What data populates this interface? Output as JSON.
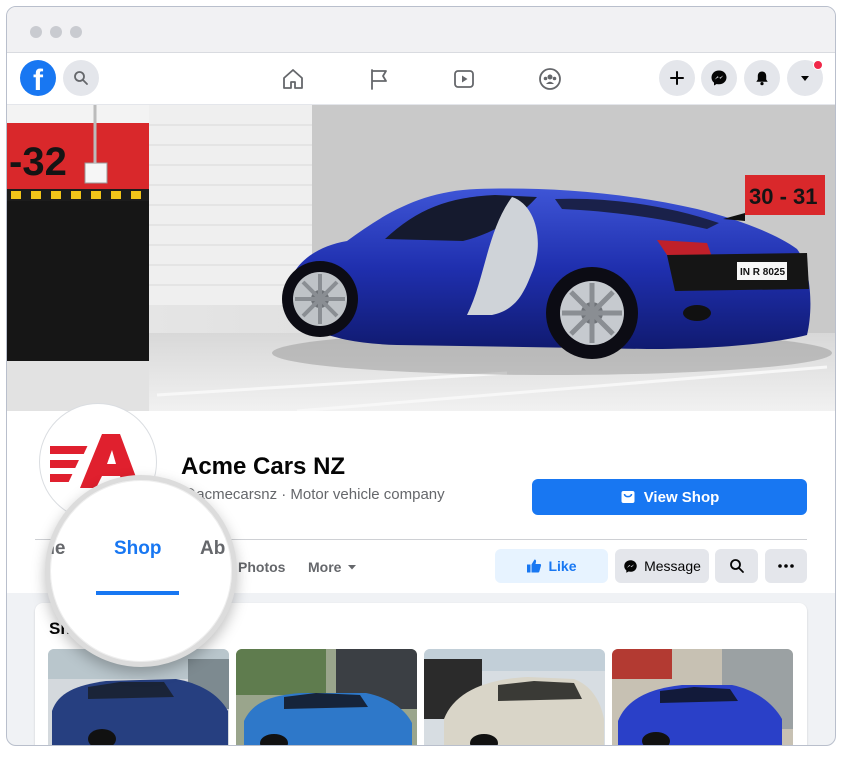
{
  "page": {
    "name": "Acme Cars NZ",
    "subtitle": "@acmecarsnz · Motor vehicle company",
    "view_shop_label": "View Shop"
  },
  "nav": {
    "logo_letter": "f",
    "icons": [
      "search-icon",
      "home-icon",
      "flag-icon",
      "video-icon",
      "groups-icon",
      "plus-icon",
      "messenger-icon",
      "bell-icon",
      "caret-down-icon"
    ],
    "notification_color": "#f02849"
  },
  "cover": {
    "sign_left": "-32",
    "sign_right": "30 - 31",
    "plate": "IN R 8025"
  },
  "tabs": {
    "home_partial": "me",
    "shop": "Shop",
    "about_partial": "Ab",
    "photos": "Photos",
    "more": "More"
  },
  "actions": {
    "like": "Like",
    "message": "Message"
  },
  "shop_section": {
    "heading_partial": "Sh"
  },
  "colors": {
    "brand_blue": "#1877f2",
    "logo_red": "#e0202e",
    "background": "#f0f2f5"
  }
}
